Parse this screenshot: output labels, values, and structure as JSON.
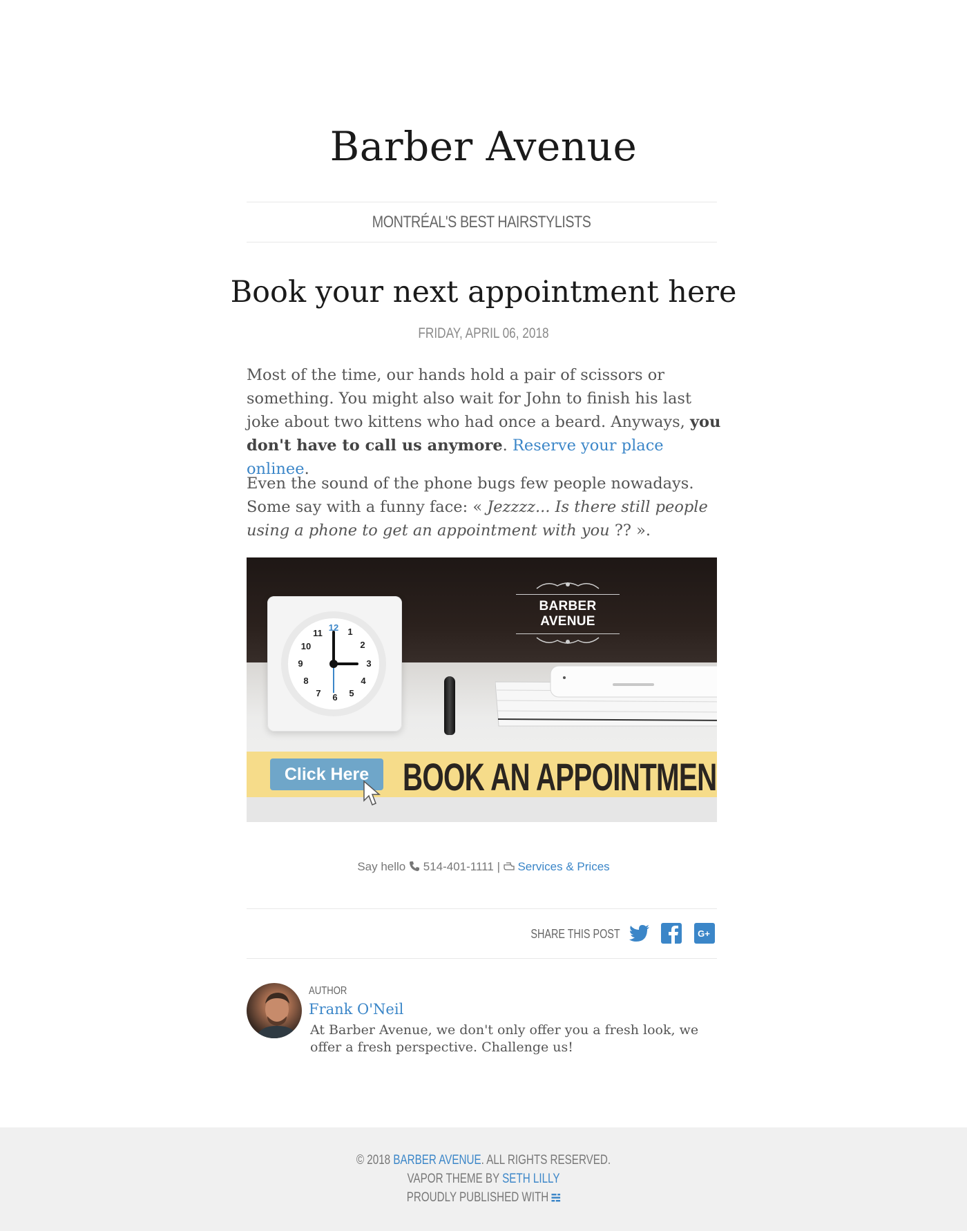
{
  "site": {
    "title": "Barber Avenue",
    "tagline": "MONTRÉAL'S BEST HAIRSTYLISTS"
  },
  "post": {
    "title": "Book your next appointment here",
    "date": "FRIDAY, APRIL 06, 2018",
    "p1": {
      "text": "Most of the time, our hands hold a pair of scissors or something. You might also wait for John to finish his last joke about two kittens who had once a beard. Anyways, ",
      "bold": "you don't have to call us anymore",
      "after_bold": ". ",
      "link": "Reserve your place onlinee",
      "end": "."
    },
    "p2": {
      "text": "Even the sound of the phone bugs few people nowadays. Some say with a funny face: « ",
      "italic": "Jezzzz... Is there still people using a phone to get an appointment with you",
      "end": " ?? »."
    },
    "banner": {
      "brand": "BARBER AVENUE",
      "button": "Click Here",
      "cta": "BOOK AN APPOINTMENT"
    }
  },
  "contact": {
    "prefix": "Say hello",
    "phone": "514-401-1111",
    "separator": "|",
    "services_link": "Services & Prices"
  },
  "share": {
    "label": "SHARE THIS POST",
    "icons": [
      "twitter-icon",
      "facebook-icon",
      "google-plus-icon"
    ]
  },
  "author": {
    "label": "AUTHOR",
    "name": "Frank O'Neil",
    "bio": "At Barber Avenue, we don't only offer you a fresh look, we offer a fresh perspective. Challenge us!"
  },
  "footer": {
    "copyright_prefix": "© 2018 ",
    "copyright_link": "BARBER AVENUE",
    "copyright_suffix": ". ALL RIGHTS RESERVED.",
    "theme_prefix": "VAPOR THEME BY ",
    "theme_link": "SETH LILLY",
    "published": "PROUDLY PUBLISHED WITH "
  },
  "colors": {
    "link": "#3b86c8",
    "footer_bg": "#f0f0f0",
    "cta_strip": "#f6dc8a",
    "button": "#6fa6c9"
  }
}
